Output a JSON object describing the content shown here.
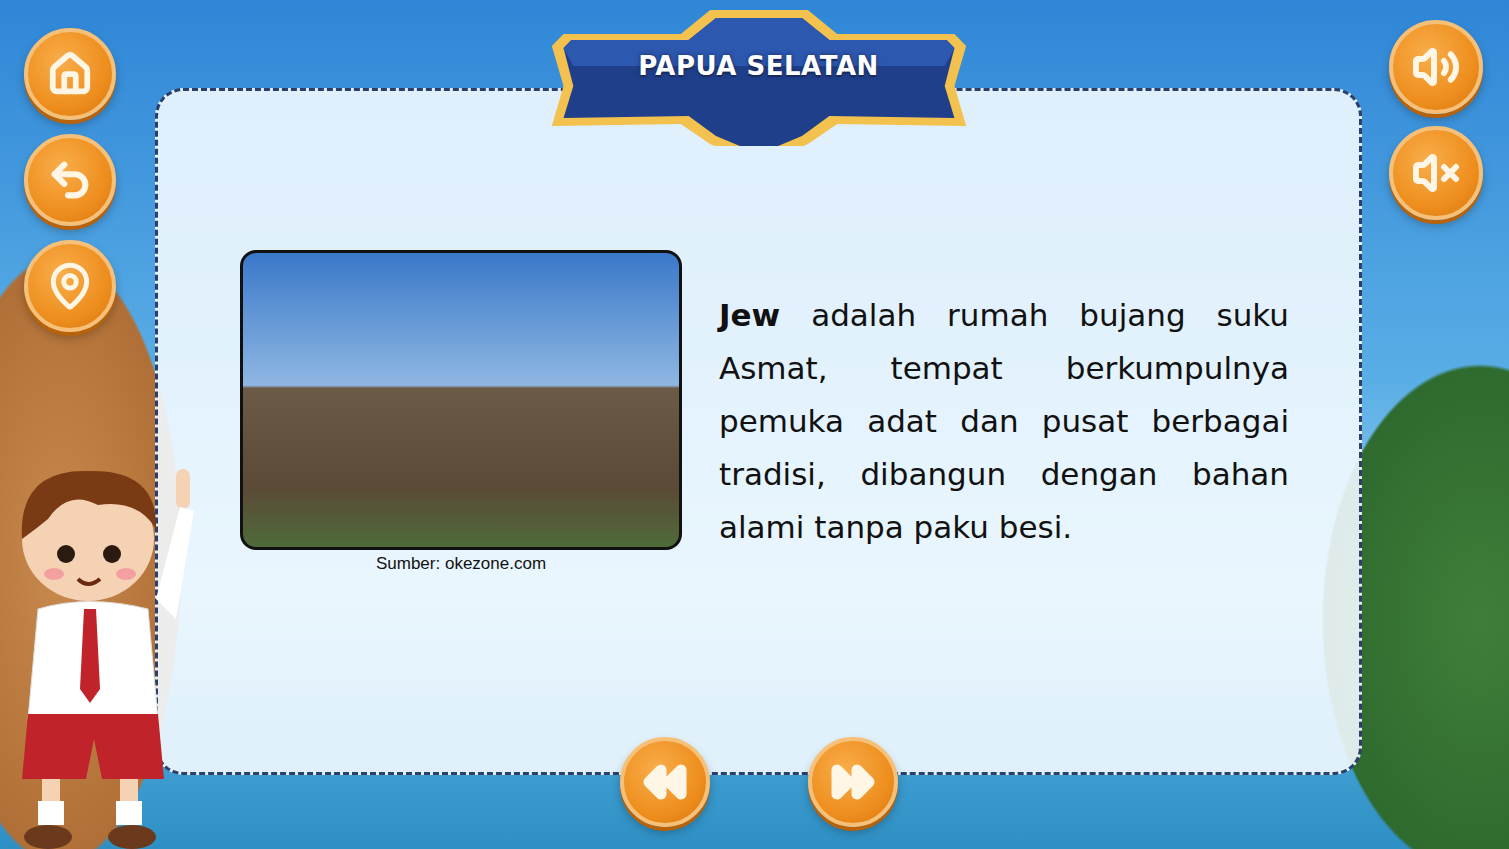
{
  "title": "PAPUA SELATAN",
  "image": {
    "caption": "Sumber: okezone.com"
  },
  "description": {
    "term": "Jew",
    "text": "adalah rumah bujang suku Asmat, tempat berkumpulnya pemuka adat dan pusat berbagai tradisi, dibangun dengan bahan alami tanpa paku besi."
  }
}
